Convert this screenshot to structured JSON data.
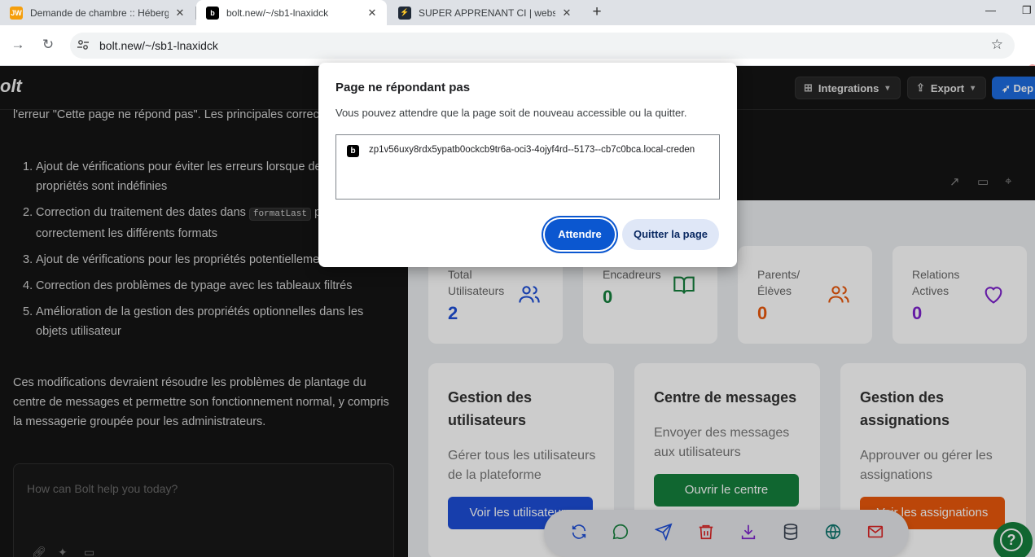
{
  "browser": {
    "tabs": [
      {
        "title": "Demande de chambre :: Héberg",
        "favicon_text": "JW",
        "favicon_color": "#f59e0b"
      },
      {
        "title": "bolt.new/~/sb1-lnaxidck",
        "favicon_text": "b",
        "favicon_color": "#000000"
      },
      {
        "title": "SUPER APPRENANT CI | website",
        "favicon_text": "⚡",
        "favicon_color": "#1f2937"
      }
    ],
    "new_tab_label": "+",
    "url": "bolt.new/~/sb1-lnaxidck"
  },
  "app": {
    "logo": "olt",
    "header_buttons": {
      "integrations": "Integrations",
      "export": "Export",
      "deploy": "Dep"
    }
  },
  "chat": {
    "intro": "l'erreur \"Cette page ne répond pas\". Les principales corrections incluent :",
    "items": [
      {
        "num": "1.",
        "text": "Ajout de vérifications pour éviter les erreurs lorsque des fonctions ou propriétés sont indéfinies"
      },
      {
        "num": "2.",
        "text_before": "Correction du traitement des dates dans ",
        "code": "formatLast",
        "text_after": " pour gérer correctement les différents formats"
      },
      {
        "num": "3.",
        "text": "Ajout de vérifications pour les propriétés potentiellement indéfinies"
      },
      {
        "num": "4.",
        "text": "Correction des problèmes de typage avec les tableaux filtrés"
      },
      {
        "num": "5.",
        "text": "Amélioration de la gestion des propriétés optionnelles dans les objets utilisateur"
      }
    ],
    "conclusion": "Ces modifications devraient résoudre les problèmes de plantage du centre de messages et permettre son fonctionnement normal, y compris la messagerie groupée pour les administrateurs.",
    "input_placeholder": "How can Bolt help you today?"
  },
  "dashboard": {
    "stats": [
      {
        "label": "Total Utilisateurs",
        "value": "2",
        "color": "#1d4ed8",
        "icon": "users-icon"
      },
      {
        "label": "Encadreurs",
        "value": "0",
        "color": "#15803d",
        "icon": "book-open-icon"
      },
      {
        "label": "Parents/ Élèves",
        "value": "0",
        "color": "#ea580c",
        "icon": "users-icon"
      },
      {
        "label": "Relations Actives",
        "value": "0",
        "color": "#7e22ce",
        "icon": "heart-icon"
      }
    ],
    "cards": [
      {
        "title": "Gestion des utilisateurs",
        "desc": "Gérer tous les utilisateurs de la plateforme",
        "button": "Voir les utilisateurs",
        "color": "#1d4ed8"
      },
      {
        "title": "Centre de messages",
        "desc": "Envoyer des messages aux utilisateurs",
        "button": "Ouvrir le centre",
        "color": "#15803d"
      },
      {
        "title": "Gestion des assignations",
        "desc": "Approuver ou gérer les assignations",
        "button": "Voir les assignations",
        "color": "#ea580c"
      }
    ],
    "dock_icons": [
      "refresh-icon",
      "chat-icon",
      "send-icon",
      "trash-icon",
      "download-icon",
      "database-icon",
      "globe-icon",
      "mail-icon"
    ],
    "help_label": "?"
  },
  "dialog": {
    "title": "Page ne répondant pas",
    "message": "Vous pouvez attendre que la page soit de nouveau accessible ou la quitter.",
    "page_icon_text": "b",
    "page_url": "zp1v56uxy8rdx5ypatb0ockcb9tr6a-oci3-4ojyf4rd--5173--cb7c0bca.local-creden",
    "wait_button": "Attendre",
    "quit_button": "Quitter la page"
  }
}
